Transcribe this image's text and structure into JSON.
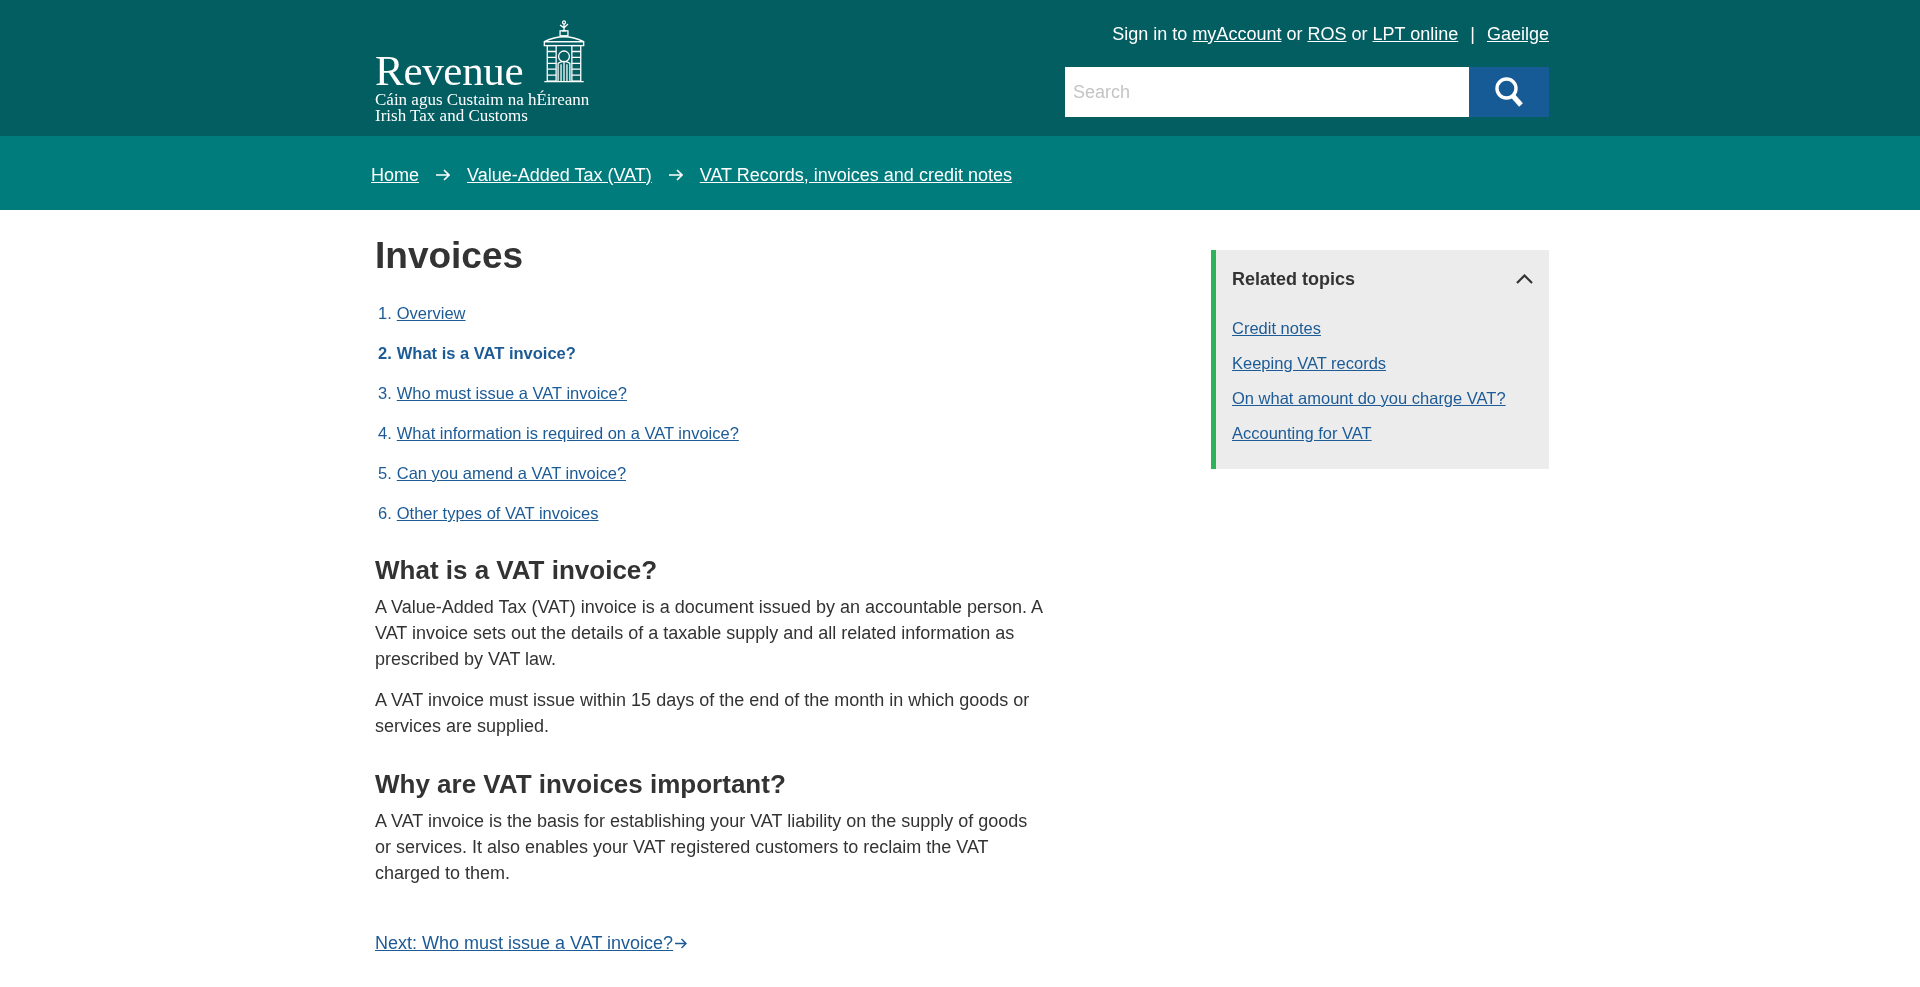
{
  "header": {
    "logo": {
      "wordmark": "Revenue",
      "tagline": [
        "Cáin agus Custaim na hÉireann",
        "Irish Tax and Customs"
      ]
    },
    "sign_in": [
      {
        "kind": "text",
        "text": "Sign in to"
      },
      {
        "kind": "link",
        "text": "myAccount"
      },
      {
        "kind": "text",
        "text": "or"
      },
      {
        "kind": "link",
        "text": "ROS"
      },
      {
        "kind": "text",
        "text": "or"
      },
      {
        "kind": "link",
        "text": "LPT online"
      }
    ],
    "separator": "|",
    "language_link": "Gaeilge",
    "search": {
      "placeholder": "Search"
    }
  },
  "breadcrumb": [
    "Home",
    "Value-Added Tax (VAT)",
    "VAT Records, invoices and credit notes"
  ],
  "article": {
    "title": "Invoices",
    "contents": [
      {
        "number": "1.",
        "label": "Overview",
        "selected": false
      },
      {
        "number": "2.",
        "label": "What is a VAT invoice?",
        "selected": true
      },
      {
        "number": "3.",
        "label": "Who must issue a VAT invoice?",
        "selected": false
      },
      {
        "number": "4.",
        "label": "What information is required on a VAT invoice?",
        "selected": false
      },
      {
        "number": "5.",
        "label": "Can you amend a VAT invoice?",
        "selected": false
      },
      {
        "number": "6.",
        "label": "Other types of VAT invoices",
        "selected": false
      }
    ],
    "sections": [
      {
        "heading": "What is a VAT invoice?",
        "paragraphs": [
          "A Value-Added Tax (VAT) invoice is a document issued by an accountable person. A VAT invoice sets out the details of a taxable supply and all related information as prescribed by VAT law.",
          "A VAT invoice must issue within 15 days of the end of the month in which goods or services are supplied."
        ]
      },
      {
        "heading": "Why are VAT invoices important?",
        "paragraphs": [
          "A VAT invoice is the basis for establishing your VAT liability on the supply of goods or services. It also enables your VAT registered customers to reclaim the VAT charged to them."
        ]
      }
    ],
    "next_link": "Next: Who must issue a VAT invoice?"
  },
  "related_topics": {
    "title": "Related topics",
    "expanded": true,
    "links": [
      "Credit notes",
      "Keeping VAT records",
      "On what amount do you charge VAT?",
      "Accounting for VAT"
    ]
  }
}
